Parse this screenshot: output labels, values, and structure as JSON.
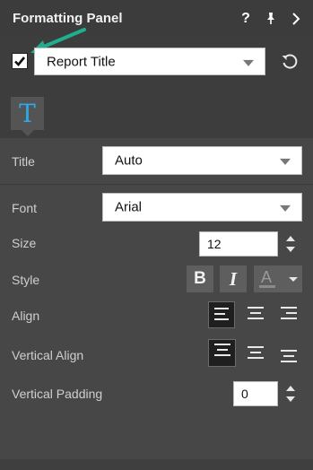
{
  "header": {
    "title": "Formatting Panel"
  },
  "object_select": {
    "value": "Report Title",
    "checked": true
  },
  "tab": {
    "glyph": "T"
  },
  "title_row": {
    "label": "Title",
    "value": "Auto"
  },
  "font_row": {
    "label": "Font",
    "value": "Arial"
  },
  "size_row": {
    "label": "Size",
    "value": "12"
  },
  "style_row": {
    "label": "Style",
    "bold": "B",
    "italic": "I",
    "font_color": "A"
  },
  "align_row": {
    "label": "Align",
    "selected": "left"
  },
  "valign_row": {
    "label": "Vertical Align",
    "selected": "top"
  },
  "vpad_row": {
    "label": "Vertical Padding",
    "value": "0"
  },
  "colors": {
    "accent": "#2ea9e6",
    "arrow": "#1faf8e"
  }
}
